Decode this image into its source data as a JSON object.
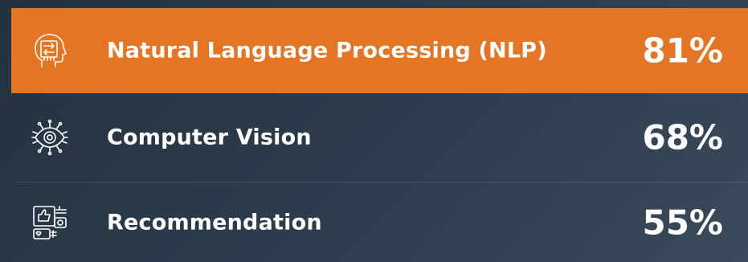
{
  "items": [
    {
      "label": "Natural Language Processing (NLP)",
      "value": "81%",
      "icon": "head-circuit-icon",
      "highlighted": true
    },
    {
      "label": "Computer Vision",
      "value": "68%",
      "icon": "eye-circuit-icon",
      "highlighted": false
    },
    {
      "label": "Recommendation",
      "value": "55%",
      "icon": "recommendation-icon",
      "highlighted": false
    }
  ],
  "colors": {
    "highlight": "#e47524",
    "background": "#2c3c4c",
    "text": "#ffffff"
  }
}
